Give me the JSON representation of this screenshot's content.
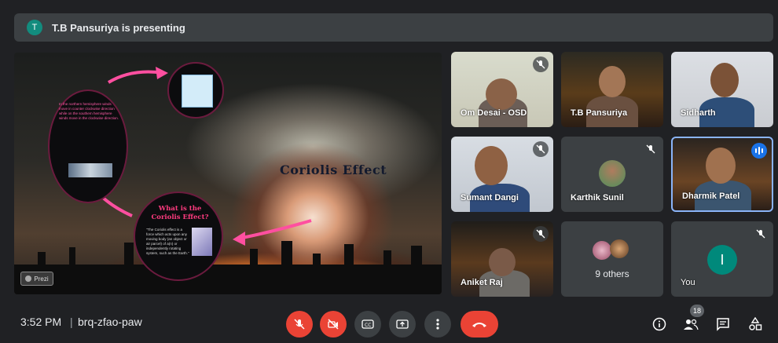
{
  "banner": {
    "avatar_letter": "T",
    "text": "T.B Pansuriya is presenting",
    "avatar_color": "#128c7e"
  },
  "presentation": {
    "title": "Coriolis Effect",
    "question": "What is the Coriolis Effect?",
    "description": "\"The Coriolis effect is a force which acts upon any moving body (an object or air parcel) of a(n) or independently rotating system, such as the Earth.\"",
    "hemisphere_text": "In the northern hemisphere winds move in counter clockwise direction while on the southern hemisphere winds move in the clockwise direction.",
    "prezi_label": "Prezi"
  },
  "participants": [
    {
      "name": "Om Desai - OSD",
      "muted": true
    },
    {
      "name": "T.B Pansuriya",
      "muted": false
    },
    {
      "name": "Sidharth",
      "muted": false
    },
    {
      "name": "Sumant Dangi",
      "muted": true
    },
    {
      "name": "Karthik Sunil",
      "muted": true
    },
    {
      "name": "Dharmik Patel",
      "muted": false,
      "speaking": true
    },
    {
      "name": "Aniket Raj",
      "muted": true
    },
    {
      "name": "9 others",
      "muted": false
    },
    {
      "name": "You",
      "muted": true,
      "avatar_letter": "I",
      "avatar_color": "#00897b"
    }
  ],
  "bottom_bar": {
    "time": "3:52 PM",
    "separator": "|",
    "meeting_code": "brq-zfao-paw",
    "controls": [
      "mic-off-icon",
      "camera-off-icon",
      "captions-icon",
      "present-icon",
      "more-icon",
      "end-call-icon"
    ],
    "right_icons": [
      "info-icon",
      "people-icon",
      "chat-icon",
      "activities-icon"
    ],
    "people_count": "18"
  },
  "colors": {
    "background": "#202124",
    "tile": "#3c4043",
    "danger": "#ea4335",
    "accent": "#8ab4f8"
  }
}
